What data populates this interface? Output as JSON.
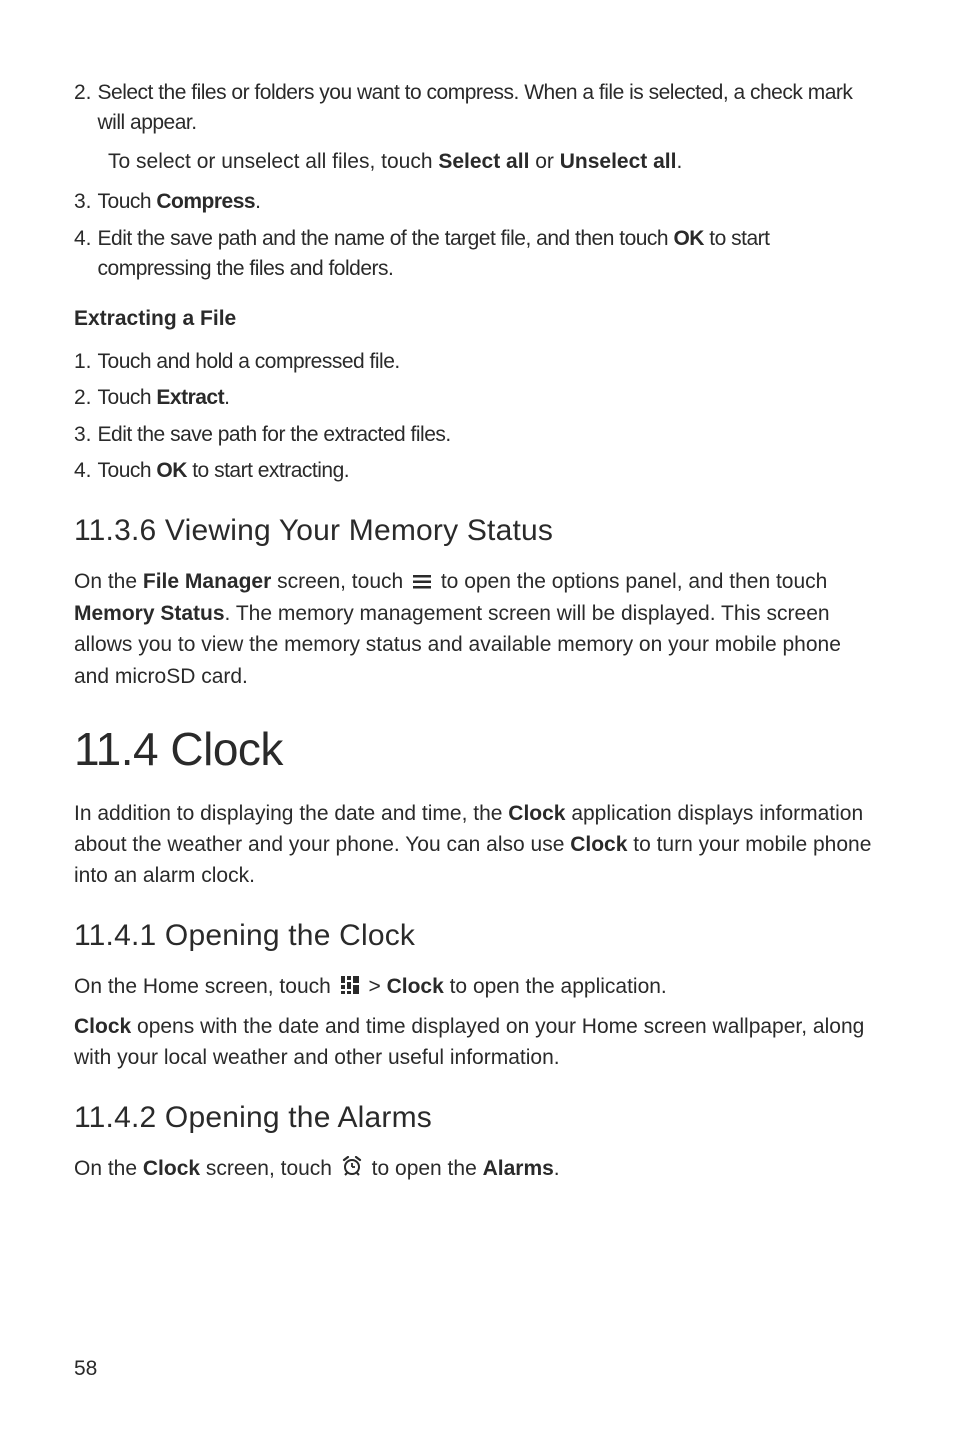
{
  "section_compress": {
    "step2": "Select the files or folders you want to compress. When a file is selected, a check mark will appear.",
    "nested_pre": "To select or unselect all files, touch ",
    "nested_b1": "Select all",
    "nested_mid": " or ",
    "nested_b2": "Unselect all",
    "nested_post": ".",
    "step3_pre": "Touch ",
    "step3_b": "Compress",
    "step3_post": ".",
    "step4_pre": "Edit the save path and the name of the target file, and then touch ",
    "step4_b": "OK",
    "step4_post": " to start compressing the files and folders."
  },
  "extracting": {
    "heading": "Extracting a File",
    "step1": "Touch and hold a compressed file.",
    "step2_pre": "Touch ",
    "step2_b": "Extract",
    "step2_post": ".",
    "step3": "Edit the save path for the extracted files.",
    "step4_pre": "Touch ",
    "step4_b": "OK",
    "step4_post": " to start extracting."
  },
  "memstatus": {
    "heading": "11.3.6  Viewing Your Memory Status",
    "p_pre": "On the ",
    "p_b1": "File Manager",
    "p_mid1": " screen, touch ",
    "p_mid2": " to open the options panel, and then touch ",
    "p_b2": "Memory Status",
    "p_post": ". The memory management screen will be displayed. This screen allows you to view the memory status and available memory on your mobile phone and microSD card."
  },
  "clock": {
    "heading": "11.4  Clock",
    "p_pre": "In addition to displaying the date and time, the ",
    "p_b1": "Clock",
    "p_mid1": " application displays information about the weather and your phone. You can also use ",
    "p_b2": "Clock",
    "p_post": " to turn your mobile phone into an alarm clock."
  },
  "openclock": {
    "heading": "11.4.1  Opening the Clock",
    "p1_pre": "On the Home screen, touch ",
    "p1_mid": " > ",
    "p1_b": "Clock",
    "p1_post": " to open the application.",
    "p2_b": "Clock",
    "p2_post": " opens with the date and time displayed on your Home screen wallpaper, along with your local weather and other useful information."
  },
  "openalarms": {
    "heading": "11.4.2  Opening the Alarms",
    "p_pre": "On the ",
    "p_b1": "Clock",
    "p_mid1": " screen, touch ",
    "p_mid2": " to open the ",
    "p_b2": "Alarms",
    "p_post": "."
  },
  "pagenum": "58"
}
